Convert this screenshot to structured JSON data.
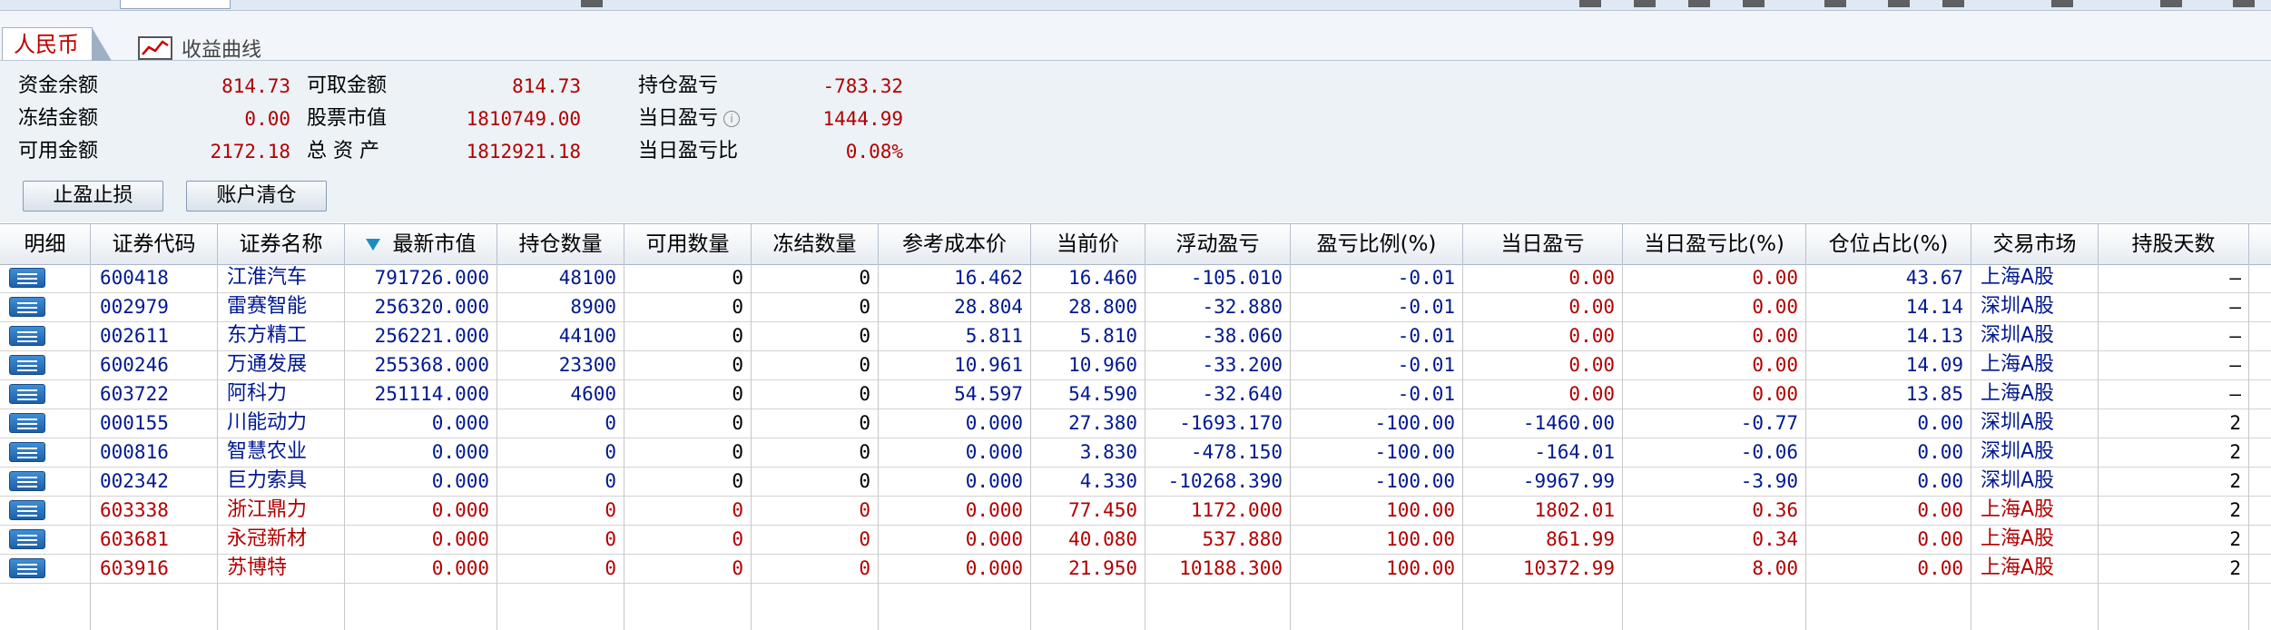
{
  "tabs": {
    "rmb": "人民币",
    "curve": "收益曲线"
  },
  "summary": {
    "cash_balance_label": "资金余额",
    "cash_balance": "814.73",
    "withdrawable_label": "可取金额",
    "withdrawable": "814.73",
    "position_pnl_label": "持仓盈亏",
    "position_pnl": "-783.32",
    "frozen_label": "冻结金额",
    "frozen": "0.00",
    "stock_value_label": "股票市值",
    "stock_value": "1810749.00",
    "daily_pnl_label": "当日盈亏",
    "daily_pnl": "1444.99",
    "available_label": "可用金额",
    "available": "2172.18",
    "total_assets_label": "总 资 产",
    "total_assets": "1812921.18",
    "daily_pnl_ratio_label": "当日盈亏比",
    "daily_pnl_ratio": "0.08%"
  },
  "buttons": {
    "stop_loss": "止盈止损",
    "clear_account": "账户清仓"
  },
  "table": {
    "headers": [
      "明细",
      "证券代码",
      "证券名称",
      "最新市值",
      "持仓数量",
      "可用数量",
      "冻结数量",
      "参考成本价",
      "当前价",
      "浮动盈亏",
      "盈亏比例(%)",
      "当日盈亏",
      "当日盈亏比(%)",
      "仓位占比(%)",
      "交易市场",
      "持股天数"
    ],
    "rows": [
      {
        "code": "600418",
        "name": "江淮汽车",
        "market_value": "791726.000",
        "qty": "48100",
        "avail": "0",
        "frozen": "0",
        "cost": "16.462",
        "price": "16.460",
        "float_pnl": "-105.010",
        "pnl_pct": "-0.01",
        "day_pnl": "0.00",
        "day_pct": "0.00",
        "weight": "43.67",
        "market": "上海A股",
        "days": "—",
        "color": "blue"
      },
      {
        "code": "002979",
        "name": "雷赛智能",
        "market_value": "256320.000",
        "qty": "8900",
        "avail": "0",
        "frozen": "0",
        "cost": "28.804",
        "price": "28.800",
        "float_pnl": "-32.880",
        "pnl_pct": "-0.01",
        "day_pnl": "0.00",
        "day_pct": "0.00",
        "weight": "14.14",
        "market": "深圳A股",
        "days": "—",
        "color": "blue"
      },
      {
        "code": "002611",
        "name": "东方精工",
        "market_value": "256221.000",
        "qty": "44100",
        "avail": "0",
        "frozen": "0",
        "cost": "5.811",
        "price": "5.810",
        "float_pnl": "-38.060",
        "pnl_pct": "-0.01",
        "day_pnl": "0.00",
        "day_pct": "0.00",
        "weight": "14.13",
        "market": "深圳A股",
        "days": "—",
        "color": "blue"
      },
      {
        "code": "600246",
        "name": "万通发展",
        "market_value": "255368.000",
        "qty": "23300",
        "avail": "0",
        "frozen": "0",
        "cost": "10.961",
        "price": "10.960",
        "float_pnl": "-33.200",
        "pnl_pct": "-0.01",
        "day_pnl": "0.00",
        "day_pct": "0.00",
        "weight": "14.09",
        "market": "上海A股",
        "days": "—",
        "color": "blue"
      },
      {
        "code": "603722",
        "name": "阿科力",
        "market_value": "251114.000",
        "qty": "4600",
        "avail": "0",
        "frozen": "0",
        "cost": "54.597",
        "price": "54.590",
        "float_pnl": "-32.640",
        "pnl_pct": "-0.01",
        "day_pnl": "0.00",
        "day_pct": "0.00",
        "weight": "13.85",
        "market": "上海A股",
        "days": "—",
        "color": "blue"
      },
      {
        "code": "000155",
        "name": "川能动力",
        "market_value": "0.000",
        "qty": "0",
        "avail": "0",
        "frozen": "0",
        "cost": "0.000",
        "price": "27.380",
        "float_pnl": "-1693.170",
        "pnl_pct": "-100.00",
        "day_pnl": "-1460.00",
        "day_pct": "-0.77",
        "weight": "0.00",
        "market": "深圳A股",
        "days": "2",
        "color": "blue"
      },
      {
        "code": "000816",
        "name": "智慧农业",
        "market_value": "0.000",
        "qty": "0",
        "avail": "0",
        "frozen": "0",
        "cost": "0.000",
        "price": "3.830",
        "float_pnl": "-478.150",
        "pnl_pct": "-100.00",
        "day_pnl": "-164.01",
        "day_pct": "-0.06",
        "weight": "0.00",
        "market": "深圳A股",
        "days": "2",
        "color": "blue"
      },
      {
        "code": "002342",
        "name": "巨力索具",
        "market_value": "0.000",
        "qty": "0",
        "avail": "0",
        "frozen": "0",
        "cost": "0.000",
        "price": "4.330",
        "float_pnl": "-10268.390",
        "pnl_pct": "-100.00",
        "day_pnl": "-9967.99",
        "day_pct": "-3.90",
        "weight": "0.00",
        "market": "深圳A股",
        "days": "2",
        "color": "blue"
      },
      {
        "code": "603338",
        "name": "浙江鼎力",
        "market_value": "0.000",
        "qty": "0",
        "avail": "0",
        "frozen": "0",
        "cost": "0.000",
        "price": "77.450",
        "float_pnl": "1172.000",
        "pnl_pct": "100.00",
        "day_pnl": "1802.01",
        "day_pct": "0.36",
        "weight": "0.00",
        "market": "上海A股",
        "days": "2",
        "color": "red"
      },
      {
        "code": "603681",
        "name": "永冠新材",
        "market_value": "0.000",
        "qty": "0",
        "avail": "0",
        "frozen": "0",
        "cost": "0.000",
        "price": "40.080",
        "float_pnl": "537.880",
        "pnl_pct": "100.00",
        "day_pnl": "861.99",
        "day_pct": "0.34",
        "weight": "0.00",
        "market": "上海A股",
        "days": "2",
        "color": "red"
      },
      {
        "code": "603916",
        "name": "苏博特",
        "market_value": "0.000",
        "qty": "0",
        "avail": "0",
        "frozen": "0",
        "cost": "0.000",
        "price": "21.950",
        "float_pnl": "10188.300",
        "pnl_pct": "100.00",
        "day_pnl": "10372.99",
        "day_pct": "8.00",
        "weight": "0.00",
        "market": "上海A股",
        "days": "2",
        "color": "red"
      }
    ]
  },
  "colors": {
    "blue_text": "#001890",
    "red_text": "#b20000",
    "panel_bg": "#edf2f7",
    "detail_icon": "#2a74c0"
  }
}
